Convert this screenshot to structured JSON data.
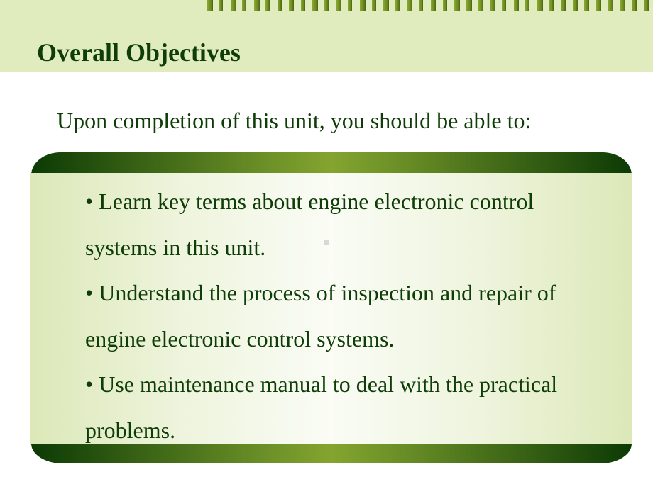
{
  "slide": {
    "title": "Overall Objectives",
    "subtitle": "Upon completion of this unit, you should be able to:",
    "objectives": [
      {
        "lines": [
          "• Learn key terms about engine electronic control",
          "systems in this unit."
        ]
      },
      {
        "lines": [
          "• Understand the process of inspection and repair of",
          "engine electronic control systems."
        ]
      },
      {
        "lines": [
          "• Use maintenance manual to deal with the practical",
          "problems."
        ]
      }
    ]
  },
  "colors": {
    "header_background": "#e1ecbe",
    "title_text": "#0f3d07",
    "accent_dark_green": "#0c3a05",
    "accent_light_green": "#84a42f"
  }
}
